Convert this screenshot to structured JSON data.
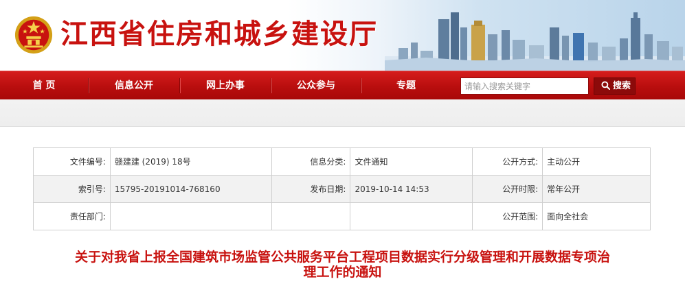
{
  "header": {
    "site_title": "江西省住房和城乡建设厅",
    "emblem_icon": "national-emblem-icon",
    "skyline_image": "city-skyline-illustration"
  },
  "nav": {
    "items": [
      {
        "label": "首 页"
      },
      {
        "label": "信息公开"
      },
      {
        "label": "网上办事"
      },
      {
        "label": "公众参与"
      },
      {
        "label": "专题"
      }
    ],
    "search": {
      "placeholder": "请输入搜索关键字",
      "button_label": "搜索",
      "button_icon": "search-icon"
    }
  },
  "info": {
    "rows": [
      [
        {
          "label": "文件编号:",
          "value": "赣建建 (2019) 18号"
        },
        {
          "label": "信息分类:",
          "value": "文件通知"
        },
        {
          "label": "公开方式:",
          "value": "主动公开"
        }
      ],
      [
        {
          "label": "索引号:",
          "value": "15795-20191014-768160"
        },
        {
          "label": "发布日期:",
          "value": "2019-10-14 14:53"
        },
        {
          "label": "公开时限:",
          "value": "常年公开"
        }
      ],
      [
        {
          "label": "责任部门:",
          "value": ""
        },
        {
          "label": "",
          "value": ""
        },
        {
          "label": "公开范围:",
          "value": "面向全社会"
        }
      ]
    ]
  },
  "article": {
    "title_line1": "关于对我省上报全国建筑市场监管公共服务平台工程项目数据实行分级管理和开展数据专项治",
    "title_line2": "理工作的通知"
  },
  "colors": {
    "brand_red": "#c8120f",
    "nav_red": "#b90e0e",
    "search_button": "#8c0a0a"
  }
}
